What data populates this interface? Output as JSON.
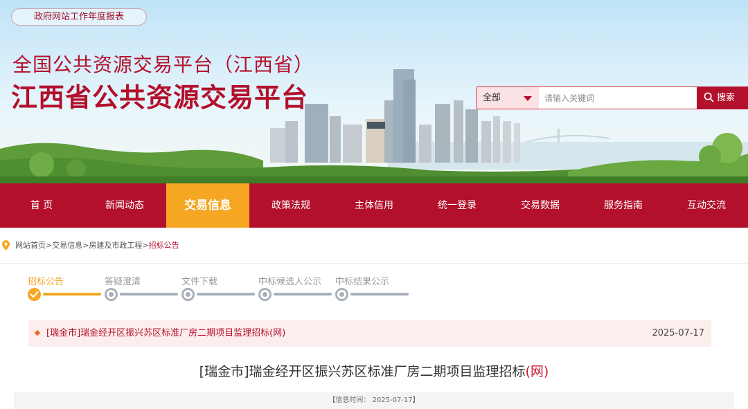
{
  "header": {
    "report_link": "政府网站工作年度报表",
    "subtitle": "全国公共资源交易平台（江西省）",
    "title": "江西省公共资源交易平台"
  },
  "search": {
    "scope_selected": "全部",
    "placeholder": "请输入关键词",
    "button_label": "搜索"
  },
  "nav": {
    "items": [
      {
        "label": "首 页"
      },
      {
        "label": "新闻动态"
      },
      {
        "label": "交易信息"
      },
      {
        "label": "政策法规"
      },
      {
        "label": "主体信用"
      },
      {
        "label": "统一登录"
      },
      {
        "label": "交易数据"
      },
      {
        "label": "服务指南"
      },
      {
        "label": "互动交流"
      }
    ],
    "active_index": 2
  },
  "breadcrumb": {
    "items": [
      "网站首页",
      "交易信息",
      "房建及市政工程"
    ],
    "separator": ">",
    "current": "招标公告"
  },
  "steps": {
    "items": [
      {
        "label": "招标公告",
        "done": true
      },
      {
        "label": "答疑澄清",
        "done": false
      },
      {
        "label": "文件下载",
        "done": false
      },
      {
        "label": "中标候选人公示",
        "done": false
      },
      {
        "label": "中标结果公示",
        "done": false
      }
    ]
  },
  "article": {
    "row_title": "[瑞金市]瑞金经开区振兴苏区标准厂房二期项目监理招标(网)",
    "row_date": "2025-07-17",
    "title_main": "[瑞金市]瑞金经开区振兴苏区标准厂房二期项目监理招标",
    "title_suffix": "(网)",
    "info": "【信息时间：  2025-07-17】"
  },
  "colors": {
    "brand_red": "#b3102b",
    "active_orange": "#f5a623",
    "step_grey": "#a8b0bb"
  }
}
